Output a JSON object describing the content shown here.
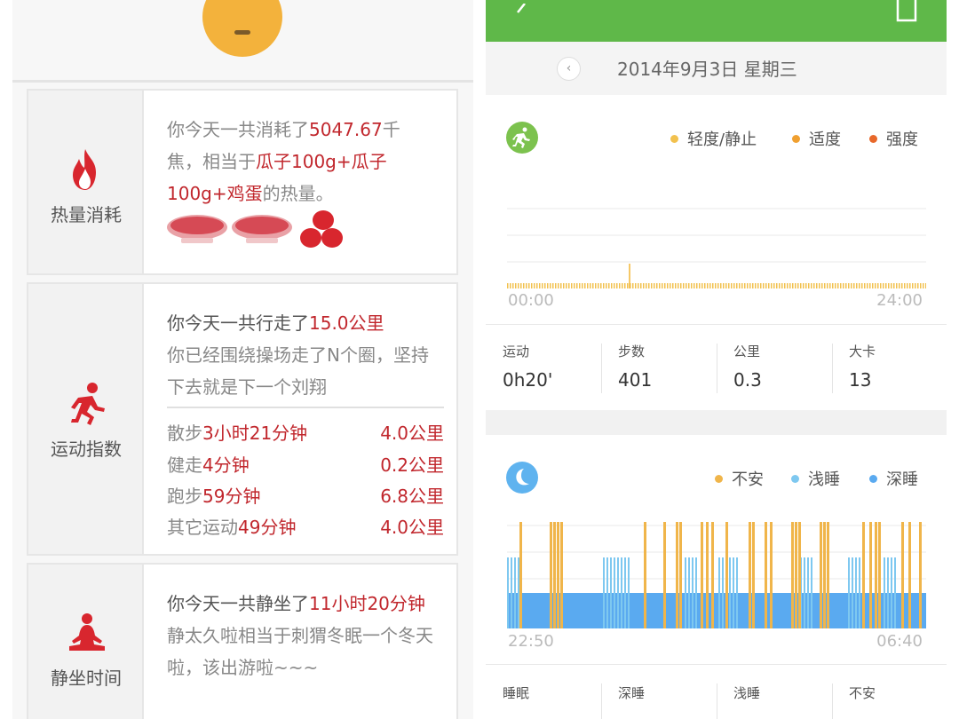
{
  "left": {
    "calorie": {
      "label": "热量消耗",
      "t1": "你今天一共消耗了",
      "v1": "5047.67",
      "t2": "千焦，相当于",
      "v2": "瓜子100g+瓜子100g+鸡蛋",
      "t3": "的热量。"
    },
    "exercise": {
      "label": "运动指数",
      "t1": "你今天一共行走了",
      "v1": "15.0公里",
      "desc": "你已经围绕操场走了N个圈，坚持下去就是下一个刘翔",
      "rows": [
        {
          "name": "散步",
          "time": "3小时21分钟",
          "dist": "4.0公里"
        },
        {
          "name": "健走",
          "time": "4分钟",
          "dist": "0.2公里"
        },
        {
          "name": "跑步",
          "time": "59分钟",
          "dist": "6.8公里"
        },
        {
          "name": "其它运动",
          "time": "49分钟",
          "dist": "4.0公里"
        }
      ]
    },
    "sitting": {
      "label": "静坐时间",
      "t1": "你今天一共静坐了",
      "v1": "11小时20分钟",
      "desc": "静太久啦相当于刺猬冬眠一个冬天啦，该出游啦~~~"
    }
  },
  "right": {
    "date": "2014年9月3日 星期三",
    "activity": {
      "legend": [
        "轻度/静止",
        "适度",
        "强度"
      ],
      "legend_colors": [
        "#f2c14e",
        "#f0a030",
        "#e8682a"
      ],
      "x_start": "00:00",
      "x_end": "24:00",
      "stats": [
        {
          "label": "运动",
          "value": "0h20'"
        },
        {
          "label": "步数",
          "value": "401"
        },
        {
          "label": "公里",
          "value": "0.3"
        },
        {
          "label": "大卡",
          "value": "13"
        }
      ]
    },
    "sleep": {
      "legend": [
        "不安",
        "浅睡",
        "深睡"
      ],
      "legend_colors": [
        "#f0b54a",
        "#7ec8f0",
        "#5aaaf0"
      ],
      "x_start": "22:50",
      "x_end": "06:40",
      "stats": [
        "睡眠",
        "深睡",
        "浅睡",
        "不安"
      ]
    }
  },
  "colors": {
    "accent_red": "#c1272d",
    "green_bar": "#5fb849"
  }
}
